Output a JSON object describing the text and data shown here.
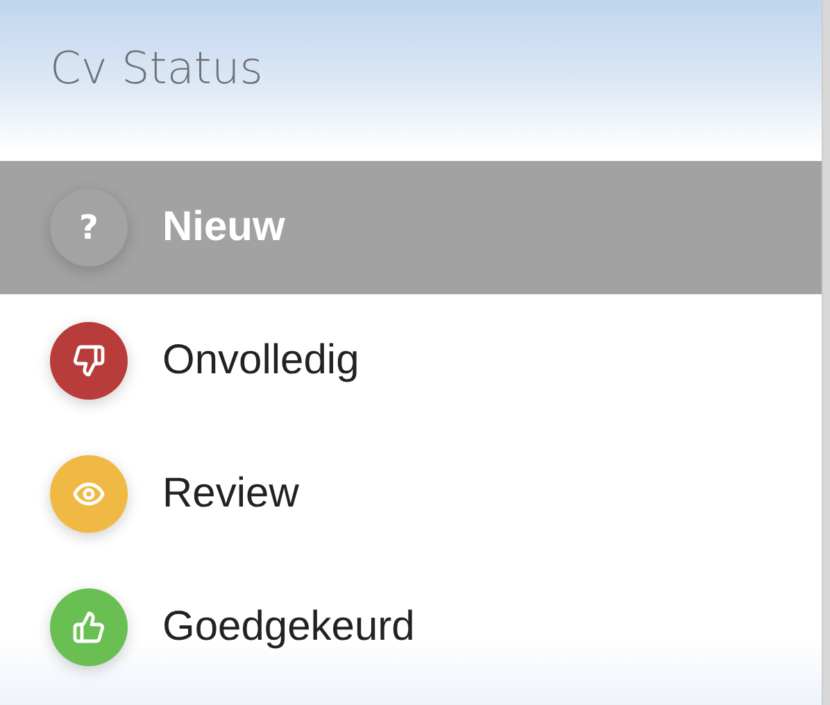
{
  "title": "Cv Status",
  "statuses": [
    {
      "label": "Nieuw",
      "kind": "glyph",
      "glyph": "?",
      "color": "#a3a3a3",
      "selected": true
    },
    {
      "label": "Onvolledig",
      "kind": "thumbs-down",
      "color": "#b83d3a",
      "selected": false
    },
    {
      "label": "Review",
      "kind": "eye",
      "color": "#f0b944",
      "selected": false
    },
    {
      "label": "Goedgekeurd",
      "kind": "thumbs-up",
      "color": "#6abf52",
      "selected": false
    }
  ]
}
